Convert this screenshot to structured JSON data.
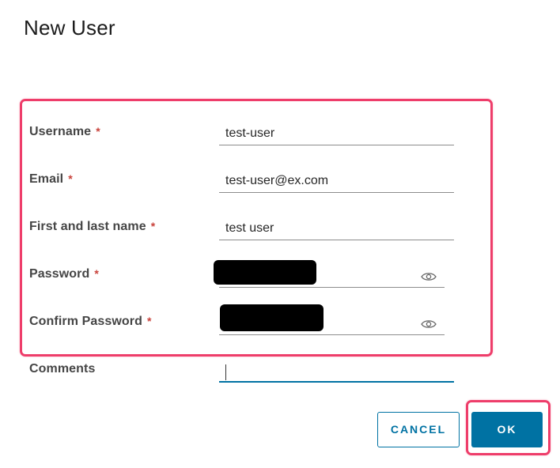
{
  "dialog": {
    "title": "New User"
  },
  "form": {
    "required_marker": "*",
    "username": {
      "label": "Username",
      "value": "test-user"
    },
    "email": {
      "label": "Email",
      "value": "test-user@ex.com"
    },
    "full_name": {
      "label": "First and last name",
      "value": "test user"
    },
    "password": {
      "label": "Password",
      "toggle_icon": "eye-icon",
      "value_state": "redacted"
    },
    "confirm_password": {
      "label": "Confirm Password",
      "toggle_icon": "eye-icon",
      "value_state": "redacted"
    },
    "comments": {
      "label": "Comments",
      "value": ""
    }
  },
  "actions": {
    "cancel_label": "CANCEL",
    "ok_label": "OK"
  },
  "colors": {
    "primary": "#0072a3",
    "required": "#c9423b",
    "highlight": "#ee3d6a"
  }
}
